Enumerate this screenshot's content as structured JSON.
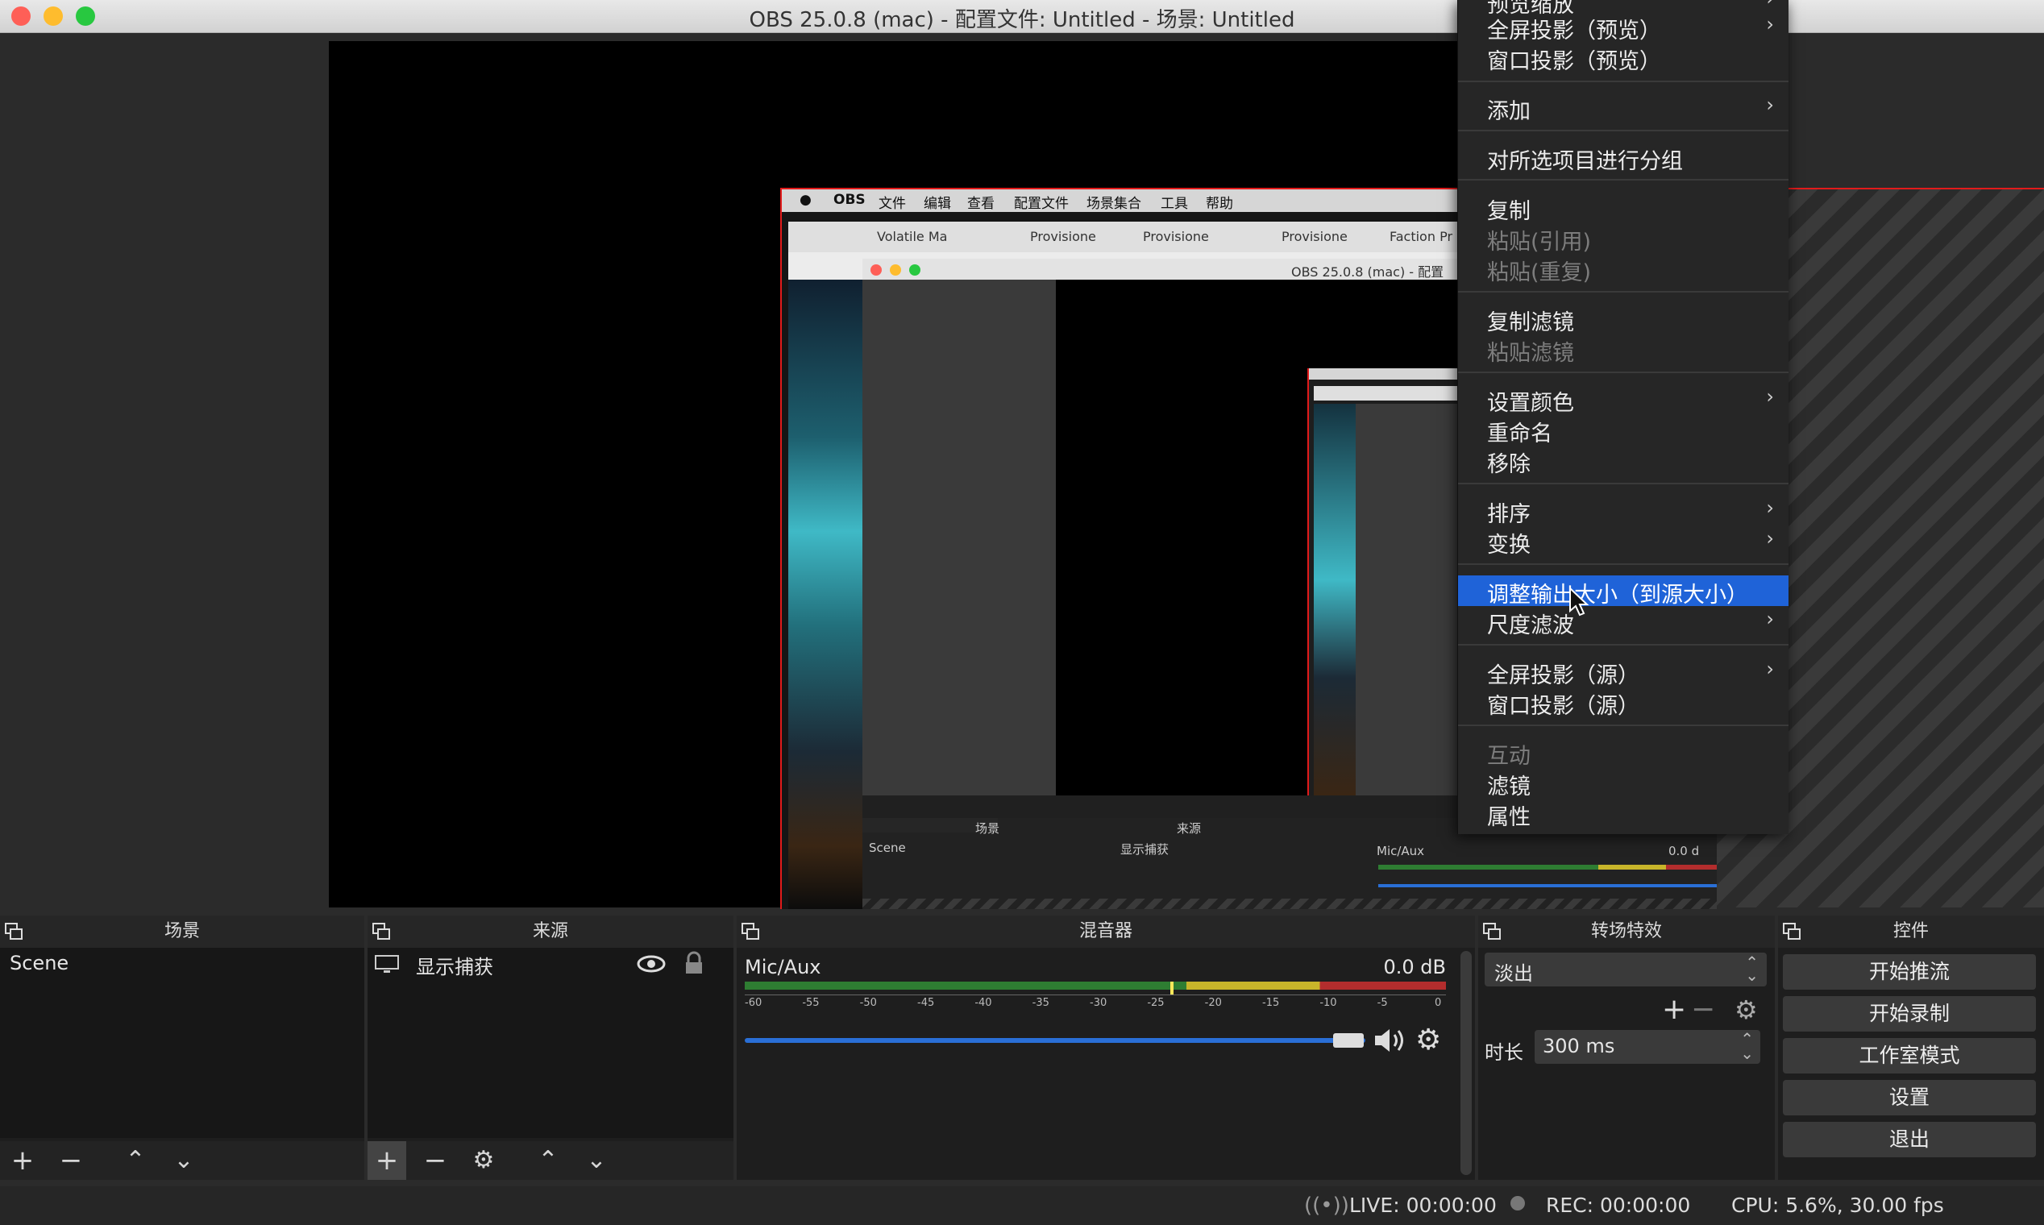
{
  "window": {
    "title": "OBS 25.0.8 (mac) - 配置文件: Untitled - 场景: Untitled"
  },
  "captured_screen": {
    "menubar": [
      "OBS",
      "文件",
      "编辑",
      "查看",
      "配置文件",
      "场景集合",
      "工具",
      "帮助"
    ],
    "browser_tabs": [
      "Volatile Ma",
      "Provisione",
      "Provisione",
      "Provisione",
      "Faction Pr"
    ],
    "inner_window_title": "OBS 25.0.8 (mac) - 配置",
    "inner_docks": {
      "scenes": "场景",
      "sources": "来源",
      "scene_item": "Scene",
      "source_item": "显示捕获",
      "mixer_track": "Mic/Aux",
      "mixer_db": "0.0 d"
    }
  },
  "context_menu": {
    "items": [
      {
        "label": "预览缩放",
        "arrow": true,
        "disabled": false
      },
      {
        "label": "全屏投影（预览）",
        "arrow": true,
        "disabled": false
      },
      {
        "label": "窗口投影（预览）",
        "arrow": false,
        "disabled": false
      },
      {
        "label": "添加",
        "arrow": true,
        "disabled": false
      },
      {
        "label": "对所选项目进行分组",
        "arrow": false,
        "disabled": false
      },
      {
        "label": "复制",
        "arrow": false,
        "disabled": false
      },
      {
        "label": "粘贴(引用)",
        "arrow": false,
        "disabled": true
      },
      {
        "label": "粘贴(重复)",
        "arrow": false,
        "disabled": true
      },
      {
        "label": "复制滤镜",
        "arrow": false,
        "disabled": false
      },
      {
        "label": "粘贴滤镜",
        "arrow": false,
        "disabled": true
      },
      {
        "label": "设置颜色",
        "arrow": true,
        "disabled": false
      },
      {
        "label": "重命名",
        "arrow": false,
        "disabled": false
      },
      {
        "label": "移除",
        "arrow": false,
        "disabled": false
      },
      {
        "label": "排序",
        "arrow": true,
        "disabled": false
      },
      {
        "label": "变换",
        "arrow": true,
        "disabled": false
      },
      {
        "label": "调整输出大小（到源大小）",
        "arrow": false,
        "disabled": false,
        "selected": true
      },
      {
        "label": "尺度滤波",
        "arrow": true,
        "disabled": false
      },
      {
        "label": "全屏投影（源）",
        "arrow": true,
        "disabled": false
      },
      {
        "label": "窗口投影（源）",
        "arrow": false,
        "disabled": false
      },
      {
        "label": "互动",
        "arrow": false,
        "disabled": true
      },
      {
        "label": "滤镜",
        "arrow": false,
        "disabled": false
      },
      {
        "label": "属性",
        "arrow": false,
        "disabled": false
      }
    ]
  },
  "scenes_dock": {
    "title": "场景",
    "items": [
      "Scene"
    ]
  },
  "sources_dock": {
    "title": "来源",
    "items": [
      {
        "name": "显示捕获",
        "visible": true,
        "locked": true
      }
    ]
  },
  "mixer_dock": {
    "title": "混音器",
    "tracks": [
      {
        "name": "Mic/Aux",
        "db": "0.0 dB",
        "volume": 1.0
      }
    ],
    "scale": [
      "-60",
      "-55",
      "-50",
      "-45",
      "-40",
      "-35",
      "-30",
      "-25",
      "-20",
      "-15",
      "-10",
      "-5",
      "0"
    ]
  },
  "transitions_dock": {
    "title": "转场特效",
    "selected": "淡出",
    "duration_label": "时长",
    "duration_value": "300 ms"
  },
  "controls_dock": {
    "title": "控件",
    "buttons": [
      "开始推流",
      "开始录制",
      "工作室模式",
      "设置",
      "退出"
    ]
  },
  "status_bar": {
    "live": "LIVE: 00:00:00",
    "rec": "REC: 00:00:00",
    "cpu": "CPU: 5.6%, 30.00 fps"
  },
  "colors": {
    "accent": "#1f63d8",
    "selection_border": "#e21b1b",
    "volume_slider": "#2a6fd6"
  },
  "icons": [
    "float-icon",
    "add-icon",
    "remove-icon",
    "up-icon",
    "down-icon",
    "gear-icon",
    "eye-icon",
    "lock-icon",
    "speaker-icon",
    "monitor-icon",
    "broadcast-icon",
    "record-dot-icon",
    "apple-icon",
    "pointer-cursor-icon"
  ]
}
